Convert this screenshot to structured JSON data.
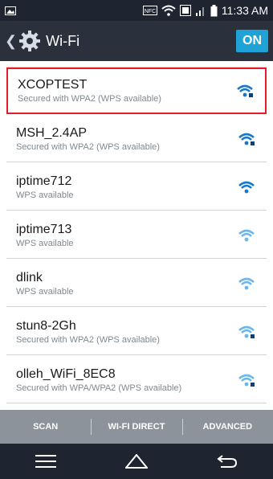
{
  "status_bar": {
    "time": "11:33 AM",
    "icons": [
      "picture-icon",
      "nfc-icon",
      "wifi-icon",
      "data-icon",
      "signal-icon",
      "battery-icon"
    ],
    "nfc_label": "NFC"
  },
  "header": {
    "title": "Wi-Fi",
    "toggle_label": "ON"
  },
  "networks": [
    {
      "ssid": "XCOPTEST",
      "subtitle": "Secured with WPA2 (WPS available)",
      "secured": true,
      "signal": 3,
      "selected": true
    },
    {
      "ssid": "MSH_2.4AP",
      "subtitle": "Secured with WPA2 (WPS available)",
      "secured": true,
      "signal": 3,
      "selected": false
    },
    {
      "ssid": "iptime712",
      "subtitle": "WPS available",
      "secured": false,
      "signal": 3,
      "selected": false
    },
    {
      "ssid": "iptime713",
      "subtitle": "WPS available",
      "secured": false,
      "signal": 2,
      "selected": false
    },
    {
      "ssid": "dlink",
      "subtitle": "WPS available",
      "secured": false,
      "signal": 2,
      "selected": false
    },
    {
      "ssid": "stun8-2Gh",
      "subtitle": "Secured with WPA2 (WPS available)",
      "secured": true,
      "signal": 2,
      "selected": false
    },
    {
      "ssid": "olleh_WiFi_8EC8",
      "subtitle": "Secured with WPA/WPA2 (WPS available)",
      "secured": true,
      "signal": 2,
      "selected": false
    }
  ],
  "bottom_bar": {
    "scan": "SCAN",
    "wifi_direct": "WI-FI DIRECT",
    "advanced": "ADVANCED"
  },
  "nav": [
    "menu-icon",
    "home-icon",
    "back-icon"
  ],
  "colors": {
    "status_bg": "#1e2530",
    "action_bg": "#2a313c",
    "accent": "#1fa3d6",
    "selection_border": "#e31b2a",
    "bottom_bar_bg": "#8c939b",
    "wifi_strong": "#1877c9",
    "wifi_weak": "#6cb6e8"
  }
}
